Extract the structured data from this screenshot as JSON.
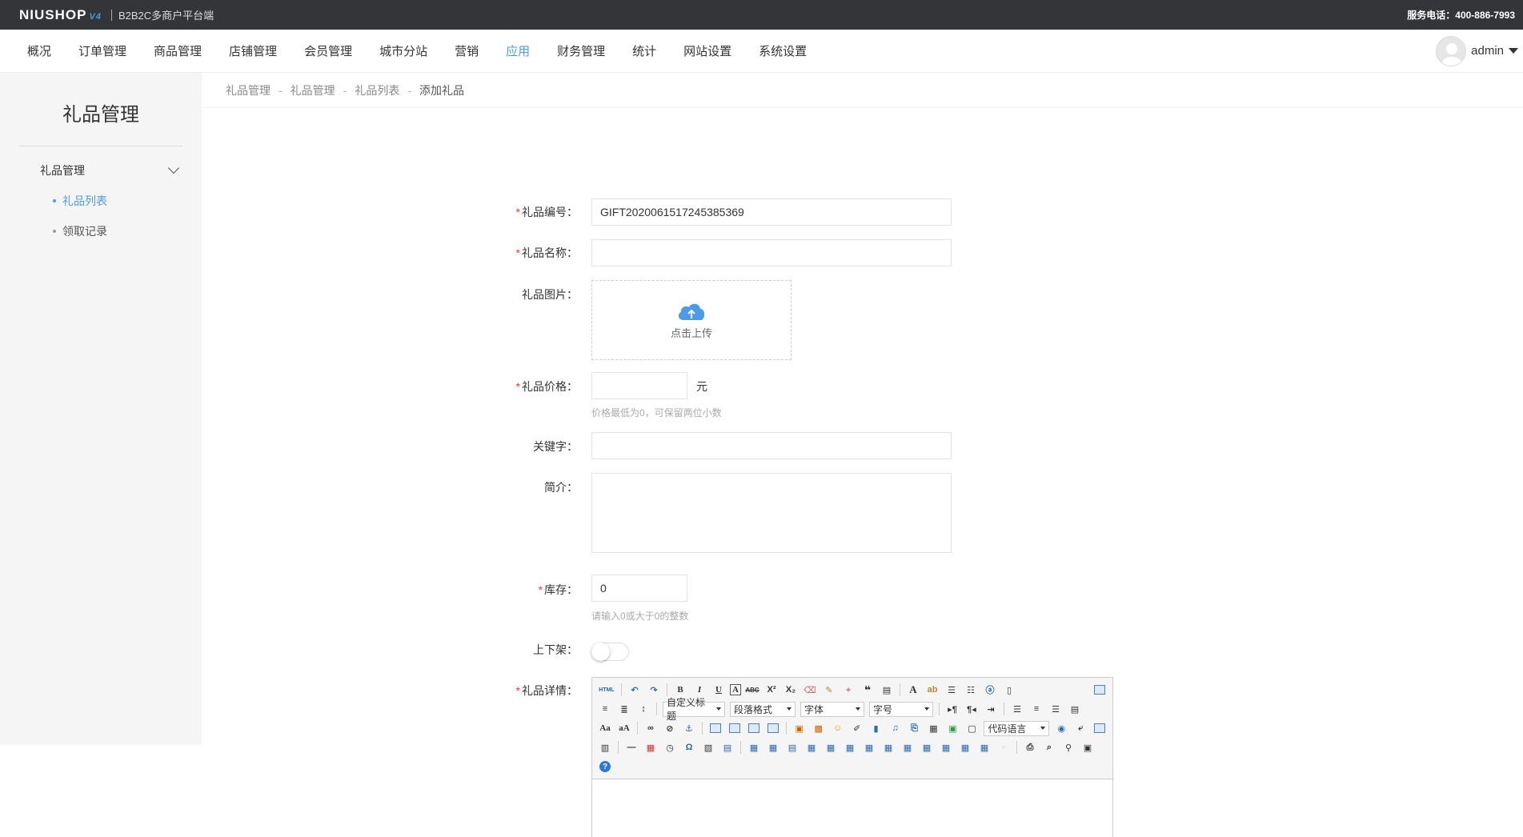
{
  "topbar": {
    "logo": "NIUSHOP",
    "logo_version": "V4",
    "platform": "B2B2C多商户平台端",
    "service": "服务电话：400-886-7993"
  },
  "nav": {
    "items": [
      "概况",
      "订单管理",
      "商品管理",
      "店铺管理",
      "会员管理",
      "城市分站",
      "营销",
      "应用",
      "财务管理",
      "统计",
      "网站设置",
      "系统设置"
    ],
    "active": "应用",
    "user": "admin"
  },
  "sidebar": {
    "title": "礼品管理",
    "group": "礼品管理",
    "subs": [
      "礼品列表",
      "领取记录"
    ],
    "active_sub": "礼品列表"
  },
  "breadcrumb": [
    "礼品管理",
    "礼品管理",
    "礼品列表",
    "添加礼品"
  ],
  "form": {
    "code_label": "礼品编号：",
    "code_value": "GIFT2020061517245385369",
    "name_label": "礼品名称：",
    "image_label": "礼品图片：",
    "upload_text": "点击上传",
    "price_label": "礼品价格：",
    "price_unit": "元",
    "price_hint": "价格最低为0，可保留两位小数",
    "keyword_label": "关键字：",
    "intro_label": "简介：",
    "stock_label": "库存：",
    "stock_value": "0",
    "stock_hint": "请输入0或大于0的整数",
    "shelf_label": "上下架：",
    "detail_label": "礼品详情："
  },
  "editor": {
    "html_btn": "HTML",
    "sel_custom_title": "自定义标题",
    "sel_paragraph": "段落格式",
    "sel_font": "字体",
    "sel_size": "字号",
    "sel_code": "代码语言",
    "help": "?"
  }
}
